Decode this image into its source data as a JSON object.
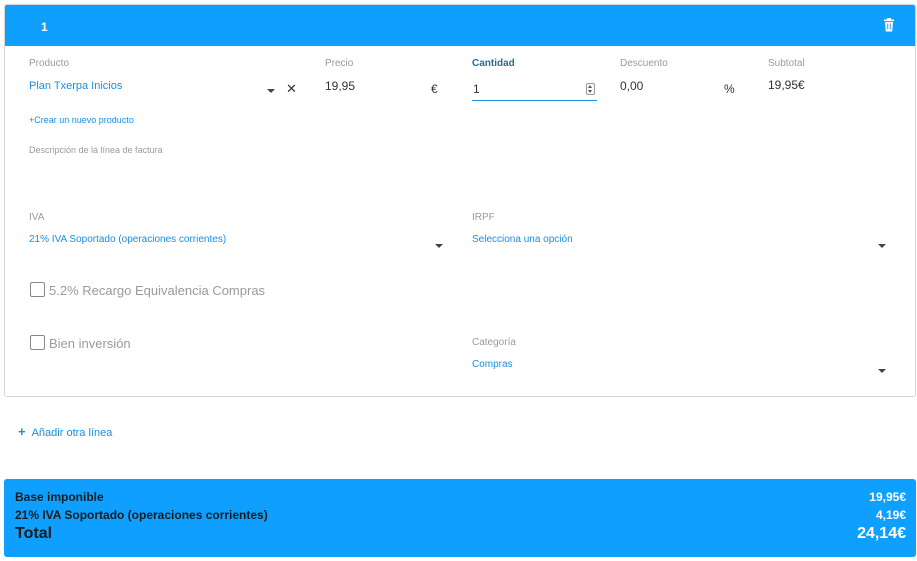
{
  "line": {
    "number": "1",
    "delete_icon": "trash-icon",
    "product": {
      "label": "Producto",
      "value": "Plan Txerpa Inicios",
      "clear_icon": "close-icon"
    },
    "price": {
      "label": "Precio",
      "value": "19,95",
      "unit": "€"
    },
    "quantity": {
      "label": "Cantidad",
      "value": "1"
    },
    "discount": {
      "label": "Descuento",
      "value": "0,00",
      "unit": "%"
    },
    "subtotal": {
      "label": "Subtotal",
      "value": "19,95€"
    },
    "create_product_link": "+Crear un nuevo producto",
    "description_label": "Descripción de la línea de factura",
    "iva": {
      "label": "IVA",
      "value": "21% IVA Soportado (operaciones corrientes)"
    },
    "irpf": {
      "label": "IRPF",
      "value": "Selecciona una opción"
    },
    "recargo": {
      "label": "5.2% Recargo Equivalencia Compras",
      "checked": false
    },
    "bien_inversion": {
      "label": "Bien inversión",
      "checked": false
    },
    "categoria": {
      "label": "Categoría",
      "value": "Compras"
    }
  },
  "add_line": {
    "icon": "plus-icon",
    "label": "Añadir otra línea"
  },
  "totals": {
    "base": {
      "label": "Base imponible",
      "value": "19,95€"
    },
    "iva": {
      "label": "21% IVA Soportado (operaciones corrientes)",
      "value": "4,19€"
    },
    "total": {
      "label": "Total",
      "value": "24,14€"
    }
  },
  "colors": {
    "accent": "#0fa0ff",
    "link": "#1a8ee0"
  }
}
